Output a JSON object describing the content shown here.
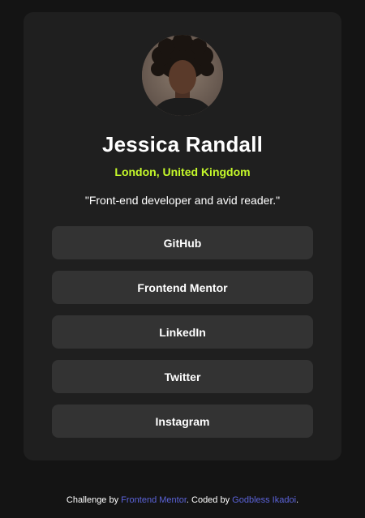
{
  "profile": {
    "name": "Jessica Randall",
    "location": "London, United Kingdom",
    "bio": "\"Front-end developer and avid reader.\""
  },
  "links": [
    {
      "label": "GitHub"
    },
    {
      "label": "Frontend Mentor"
    },
    {
      "label": "LinkedIn"
    },
    {
      "label": "Twitter"
    },
    {
      "label": "Instagram"
    }
  ],
  "footer": {
    "prefix": "Challenge by ",
    "challenge_link": "Frontend Mentor",
    "middle": ". Coded by ",
    "author_link": "Godbless Ikadoi",
    "suffix": "."
  },
  "colors": {
    "page_background": "#141414",
    "card_background": "#1f1f1f",
    "button_background": "#333333",
    "accent": "#c4f82a",
    "link": "#5b63d9"
  }
}
